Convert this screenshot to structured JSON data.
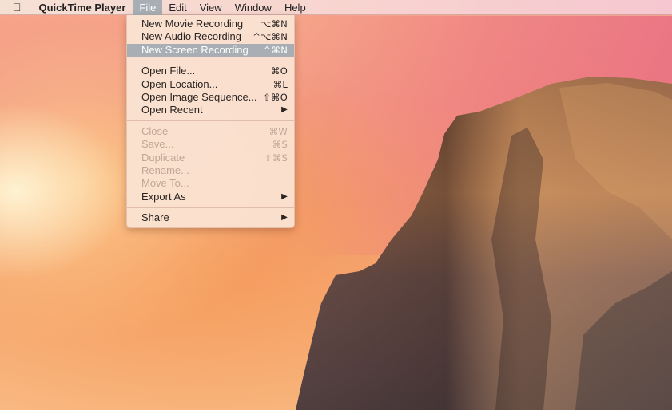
{
  "menubar": {
    "apple_icon": "apple-icon",
    "app_name": "QuickTime Player",
    "items": [
      {
        "label": "File",
        "active": true
      },
      {
        "label": "Edit",
        "active": false
      },
      {
        "label": "View",
        "active": false
      },
      {
        "label": "Window",
        "active": false
      },
      {
        "label": "Help",
        "active": false
      }
    ]
  },
  "file_menu": {
    "groups": [
      [
        {
          "label": "New Movie Recording",
          "shortcut": "⌥⌘N",
          "enabled": true,
          "highlighted": false
        },
        {
          "label": "New Audio Recording",
          "shortcut": "^⌥⌘N",
          "enabled": true,
          "highlighted": false
        },
        {
          "label": "New Screen Recording",
          "shortcut": "^⌘N",
          "enabled": true,
          "highlighted": true
        }
      ],
      [
        {
          "label": "Open File...",
          "shortcut": "⌘O",
          "enabled": true
        },
        {
          "label": "Open Location...",
          "shortcut": "⌘L",
          "enabled": true
        },
        {
          "label": "Open Image Sequence...",
          "shortcut": "⇧⌘O",
          "enabled": true
        },
        {
          "label": "Open Recent",
          "shortcut": "▶",
          "enabled": true,
          "submenu": true
        }
      ],
      [
        {
          "label": "Close",
          "shortcut": "⌘W",
          "enabled": false
        },
        {
          "label": "Save...",
          "shortcut": "⌘S",
          "enabled": false
        },
        {
          "label": "Duplicate",
          "shortcut": "⇧⌘S",
          "enabled": false
        },
        {
          "label": "Rename...",
          "shortcut": "",
          "enabled": false
        },
        {
          "label": "Move To...",
          "shortcut": "",
          "enabled": false
        },
        {
          "label": "Export As",
          "shortcut": "▶",
          "enabled": true,
          "submenu": true
        }
      ],
      [
        {
          "label": "Share",
          "shortcut": "▶",
          "enabled": true,
          "submenu": true
        }
      ]
    ]
  },
  "colors": {
    "highlight": "#a8aeb3",
    "disabled_text": "#c2a596"
  }
}
